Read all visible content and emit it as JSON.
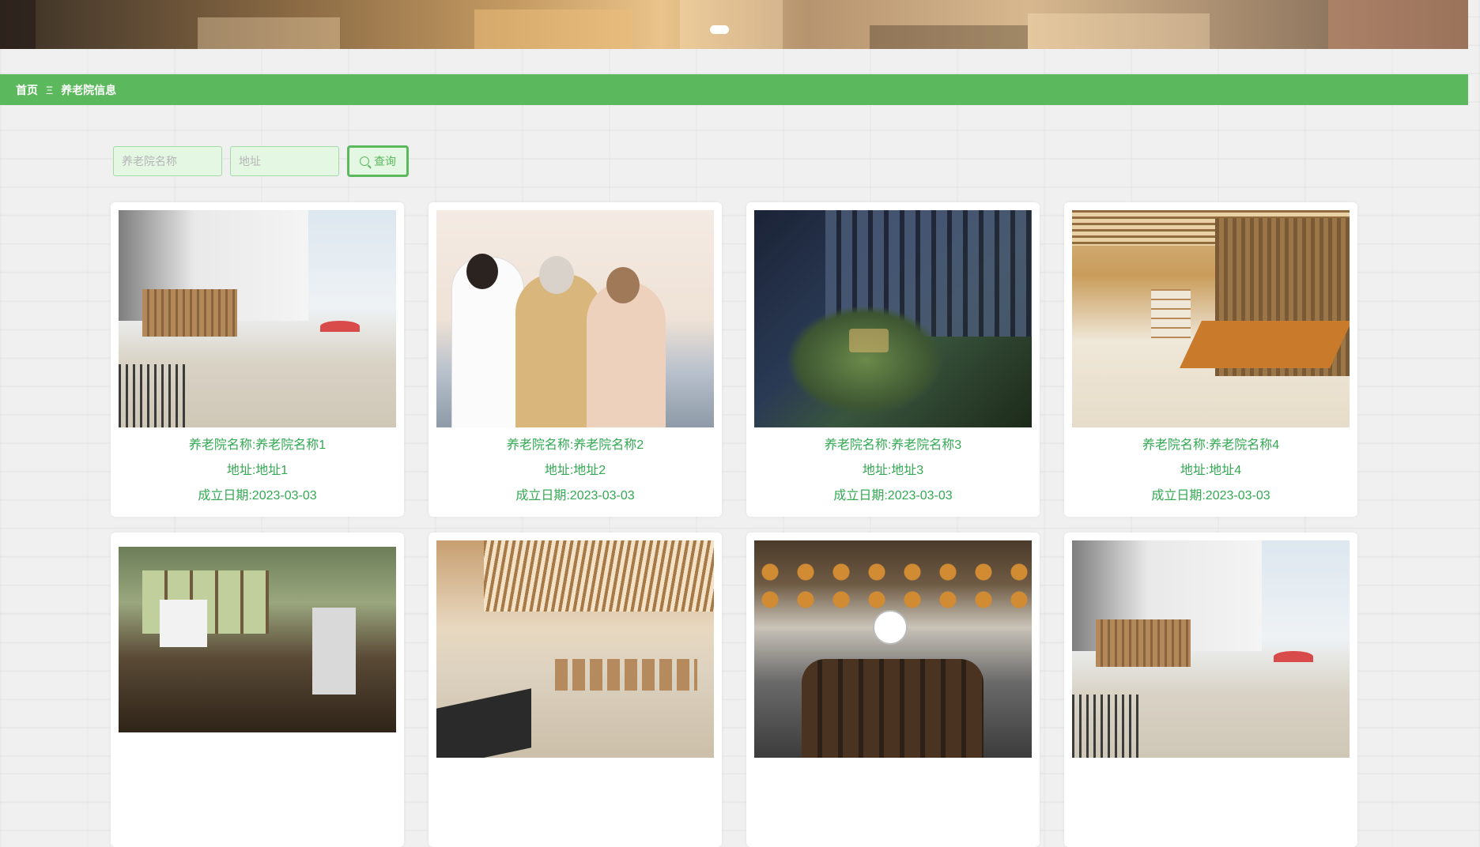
{
  "breadcrumb": {
    "home": "首页",
    "separator": "Ξ",
    "current": "养老院信息"
  },
  "search": {
    "name_placeholder": "养老院名称",
    "address_placeholder": "地址",
    "button_label": "查询",
    "button_icon": "search-icon"
  },
  "carousel": {
    "indicator": "active-dot"
  },
  "colors": {
    "nav_bar": "#5cb85c",
    "card_text": "#34a853",
    "input_bg": "#e3f7e3"
  },
  "cards": [
    {
      "name": "养老院名称:养老院名称1",
      "address": "地址:地址1",
      "date": "成立日期:2023-03-03",
      "image": "rooftop-terrace-photo"
    },
    {
      "name": "养老院名称:养老院名称2",
      "address": "地址:地址2",
      "date": "成立日期:2023-03-03",
      "image": "doctor-with-elderly-couple-photo"
    },
    {
      "name": "养老院名称:养老院名称3",
      "address": "地址:地址3",
      "date": "成立日期:2023-03-03",
      "image": "courtyard-night-photo"
    },
    {
      "name": "养老院名称:养老院名称4",
      "address": "地址:地址4",
      "date": "成立日期:2023-03-03",
      "image": "tea-room-photo"
    },
    {
      "image": "activity-room-photo"
    },
    {
      "image": "fitness-hall-photo"
    },
    {
      "image": "dining-hall-photo"
    },
    {
      "image": "rooftop-terrace-photo"
    }
  ]
}
